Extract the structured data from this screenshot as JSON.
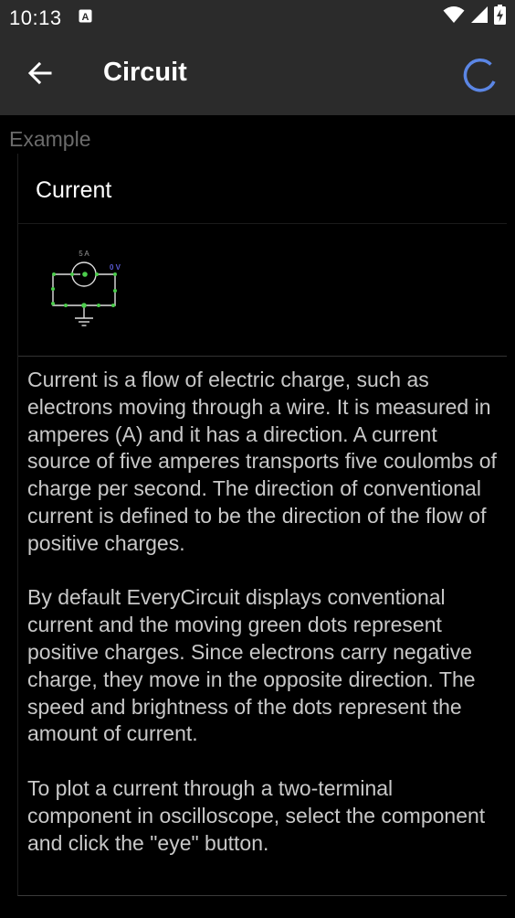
{
  "status_bar": {
    "time": "10:13",
    "app_icon": "a-notification-icon",
    "icons": [
      "wifi-icon",
      "signal-icon",
      "battery-charging-icon"
    ]
  },
  "app_bar": {
    "back_icon": "back-arrow-icon",
    "title": "Circuit",
    "spinner_icon": "loading-spinner-icon",
    "accent_color": "#5b86e5",
    "background_color": "#2b2b2b"
  },
  "section": {
    "label": "Example"
  },
  "card": {
    "title": "Current",
    "thumbnail": {
      "source_label": "5 A",
      "node_label": "0 V",
      "node_label_color": "#5b5bd6",
      "wire_dot_color": "#4ccd4c"
    },
    "paragraphs": [
      "Current is a flow of electric charge, such as electrons moving through a wire. It is measured in amperes (A) and it has a direction. A current source of five amperes transports five coulombs of charge per second. The direction of conventional current is defined to be the direction of the flow of positive charges.",
      "By default EveryCircuit displays conventional current and the moving green dots represent positive charges. Since electrons carry negative charge, they move in the opposite direction. The speed and brightness of the dots represent the amount of current.",
      "To plot a current through a two-terminal component in oscilloscope, select the component and click the \"eye\" button."
    ]
  }
}
